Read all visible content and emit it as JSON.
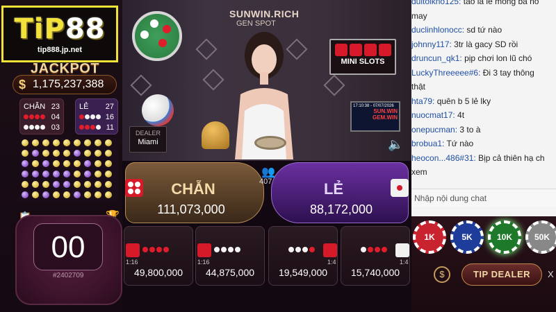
{
  "logo": {
    "mark_a": "TiP",
    "mark_b": "88",
    "url": "tip888.jp.net"
  },
  "jackpot": {
    "title": "JACKPOT",
    "currency": "$",
    "amount": "1,175,237,388"
  },
  "stats": {
    "chan": {
      "label": "CHẴN",
      "total": "23",
      "row1": "04",
      "row2": "03"
    },
    "le": {
      "label": "LẺ",
      "total": "27",
      "row1": "16",
      "row2": "11"
    }
  },
  "road_rows": [
    [
      "y",
      "y",
      "y",
      "y",
      "y",
      "y",
      "y",
      "y",
      "y"
    ],
    [
      "y",
      "p",
      "y",
      "y",
      "y",
      "p",
      "y",
      "y",
      "y"
    ],
    [
      "p",
      "y",
      "p",
      "y",
      "y",
      "y",
      "p",
      "y",
      "y"
    ],
    [
      "p",
      "p",
      "p",
      "p",
      "p",
      "y",
      "p",
      "y",
      "y"
    ],
    [
      "y",
      "y",
      "y",
      "p",
      "p",
      "y",
      "y",
      "y",
      "y"
    ],
    [
      "p",
      "y",
      "p",
      "y",
      "y",
      "p",
      "y",
      "y",
      "y"
    ]
  ],
  "timer": {
    "value": "00",
    "round": "#2402709"
  },
  "stage": {
    "brand_title": "SUNWIN.RICH",
    "brand_sub": "GEN   SPOT",
    "mini_slots": "MINI SLOTS",
    "monitor_text": "SUN.WIN GEM.WIN",
    "monitor_time": "17:10:38 - 07/07/2026",
    "dealer_caption": "DEALER",
    "dealer_name": "Miami"
  },
  "bets": {
    "chan": {
      "label": "CHẴN",
      "amount": "111,073,000"
    },
    "le": {
      "label": "LẺ",
      "amount": "88,172,000"
    },
    "players": "407"
  },
  "side_bets": [
    {
      "ratio": "1:16",
      "amount": "49,800,000",
      "balls": [
        "r",
        "r",
        "r",
        "r"
      ]
    },
    {
      "ratio": "1:16",
      "amount": "44,875,000",
      "balls": [
        "w",
        "w",
        "w",
        "w"
      ]
    },
    {
      "ratio": "1:4",
      "amount": "19,549,000",
      "balls": [
        "w",
        "w",
        "w",
        "r"
      ]
    },
    {
      "ratio": "1:4",
      "amount": "15,740,000",
      "balls": [
        "w",
        "r",
        "r",
        "r"
      ]
    }
  ],
  "chat": {
    "messages": [
      {
        "user": "duitoikno125:",
        "text": "tao là lê mông ba nó"
      },
      {
        "user": "",
        "text": "may"
      },
      {
        "user": "duclinhlonocc:",
        "text": "sd tứ nào"
      },
      {
        "user": "johnny117:",
        "text": "3tr là gacy SD rồi"
      },
      {
        "user": "druncun_qk1:",
        "text": "pịp chơi lon lũ chó"
      },
      {
        "user": "LuckyThreeeee#6:",
        "text": "Đi 3 tay thông"
      },
      {
        "user": "",
        "text": "thật"
      },
      {
        "user": "hta79:",
        "text": "quên b 5 lẻ lky"
      },
      {
        "user": "nuocmat17:",
        "text": "4t"
      },
      {
        "user": "onepucman:",
        "text": "3 to à"
      },
      {
        "user": "brobua1:",
        "text": "Tứ nào"
      },
      {
        "user": "heocon...486#31:",
        "text": "Bịp cả thiên hạ ch"
      },
      {
        "user": "",
        "text": "xem"
      }
    ],
    "input_placeholder": "Nhập nội dung chat"
  },
  "chips": [
    "1K",
    "5K",
    "10K",
    "50K"
  ],
  "tip_button": "TIP DEALER",
  "close_glyph": "X",
  "coin_glyph": "$"
}
